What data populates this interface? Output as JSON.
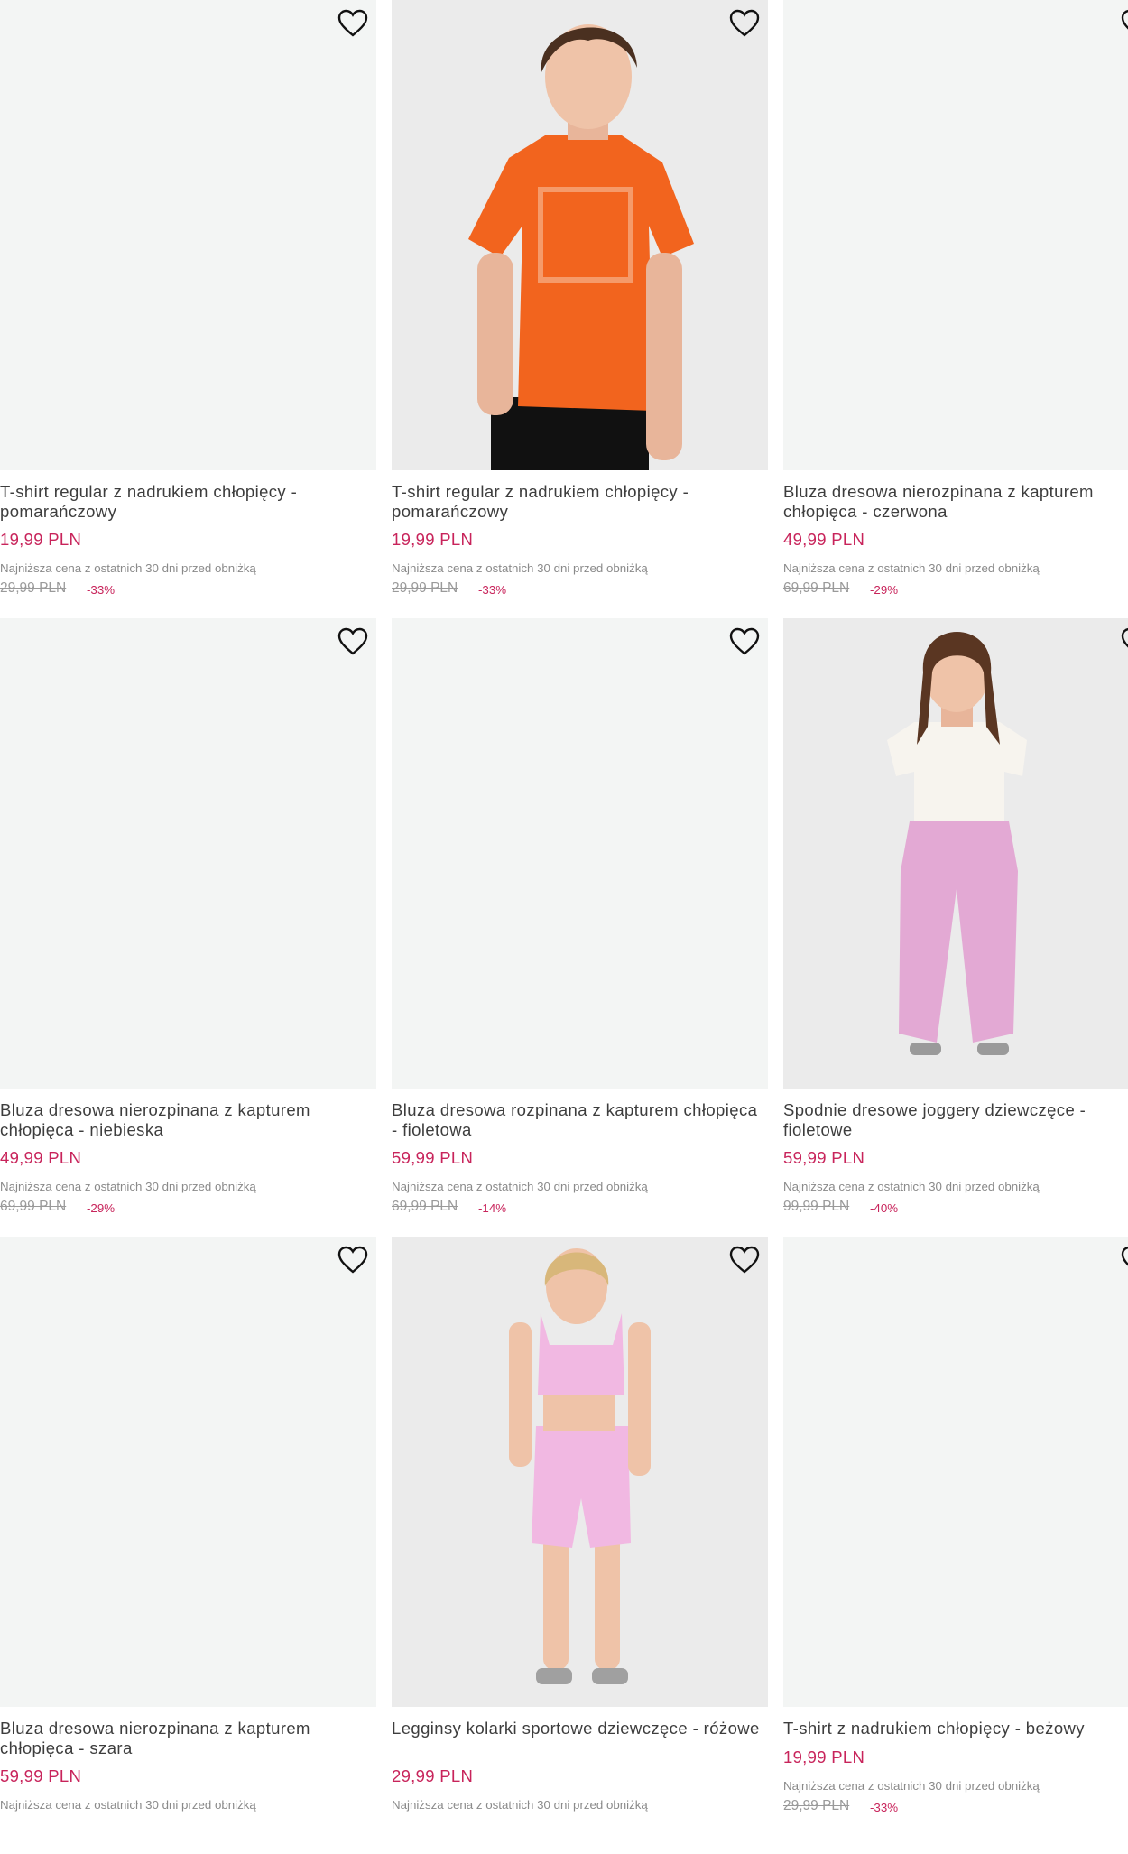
{
  "products": [
    {
      "title": "T-shirt regular z nadrukiem chłopięcy - pomarańczowy",
      "price": "19,99 PLN",
      "lowest_label": "Najniższa cena z ostatnich 30 dni przed obniżką",
      "old_price": "29,99 PLN",
      "discount": "-33%"
    },
    {
      "title": "T-shirt regular z nadrukiem chłopięcy - pomarańczowy",
      "price": "19,99 PLN",
      "lowest_label": "Najniższa cena z ostatnich 30 dni przed obniżką",
      "old_price": "29,99 PLN",
      "discount": "-33%"
    },
    {
      "title": "Bluza dresowa nierozpinana z kapturem chłopięca - czerwona",
      "price": "49,99 PLN",
      "lowest_label": "Najniższa cena z ostatnich 30 dni przed obniżką",
      "old_price": "69,99 PLN",
      "discount": "-29%"
    },
    {
      "title": "Bluza dresowa nierozpinana z kapturem chłopięca - niebieska",
      "price": "49,99 PLN",
      "lowest_label": "Najniższa cena z ostatnich 30 dni przed obniżką",
      "old_price": "69,99 PLN",
      "discount": "-29%"
    },
    {
      "title": "Bluza dresowa rozpinana z kapturem chłopięca - fioletowa",
      "price": "59,99 PLN",
      "lowest_label": "Najniższa cena z ostatnich 30 dni przed obniżką",
      "old_price": "69,99 PLN",
      "discount": "-14%"
    },
    {
      "title": "Spodnie dresowe joggery dziewczęce - fioletowe",
      "price": "59,99 PLN",
      "lowest_label": "Najniższa cena z ostatnich 30 dni przed obniżką",
      "old_price": "99,99 PLN",
      "discount": "-40%"
    },
    {
      "title": "Bluza dresowa nierozpinana z kapturem chłopięca - szara",
      "price": "59,99 PLN",
      "lowest_label": "Najniższa cena z ostatnich 30 dni przed obniżką",
      "old_price": "",
      "discount": ""
    },
    {
      "title": "Legginsy kolarki sportowe dziewczęce - różowe",
      "price": "29,99 PLN",
      "lowest_label": "Najniższa cena z ostatnich 30 dni przed obniżką",
      "old_price": "",
      "discount": ""
    },
    {
      "title": "T-shirt z nadrukiem chłopięcy - beżowy",
      "price": "19,99 PLN",
      "lowest_label": "Najniższa cena z ostatnich 30 dni przed obniżką",
      "old_price": "29,99 PLN",
      "discount": "-33%"
    }
  ],
  "icons": {
    "wishlist": "heart-outline-icon"
  },
  "colors": {
    "price": "#c8245b",
    "image_bg": "#f3f5f4",
    "text": "#3d3d3d"
  }
}
